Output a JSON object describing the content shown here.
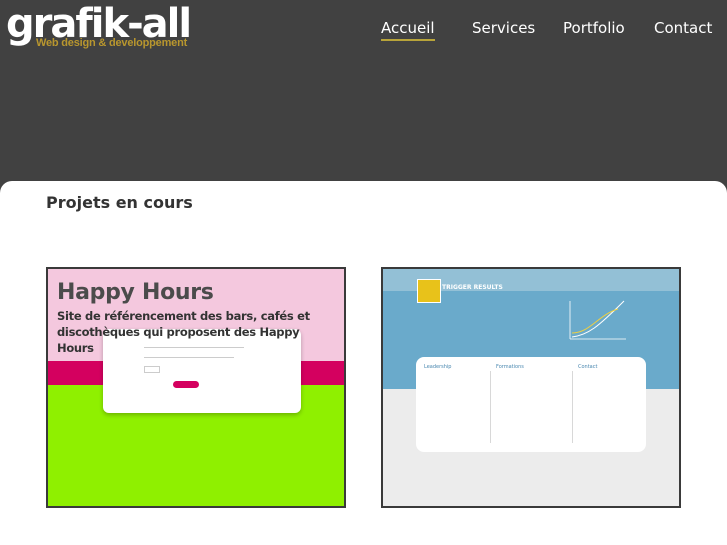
{
  "logo": {
    "name": "grafik-all",
    "tagline": "Web design & developpement"
  },
  "nav": [
    {
      "label": "Accueil",
      "active": true
    },
    {
      "label": "Services",
      "active": false
    },
    {
      "label": "Portfolio",
      "active": false
    },
    {
      "label": "Contact",
      "active": false
    }
  ],
  "section": {
    "title": "Projets en cours"
  },
  "projects": [
    {
      "title": "Happy Hours",
      "description": "Site de référencement des bars, cafés et discothèques qui proposent des Happy Hours"
    },
    {
      "logo_text": "TRIGGER RESULTS",
      "columns": [
        "Leadership",
        "Formations",
        "Contact"
      ]
    }
  ],
  "colors": {
    "header_bg": "#414141",
    "nav_active_underline": "#b8a43a",
    "logo_tagline": "#b8962e"
  }
}
